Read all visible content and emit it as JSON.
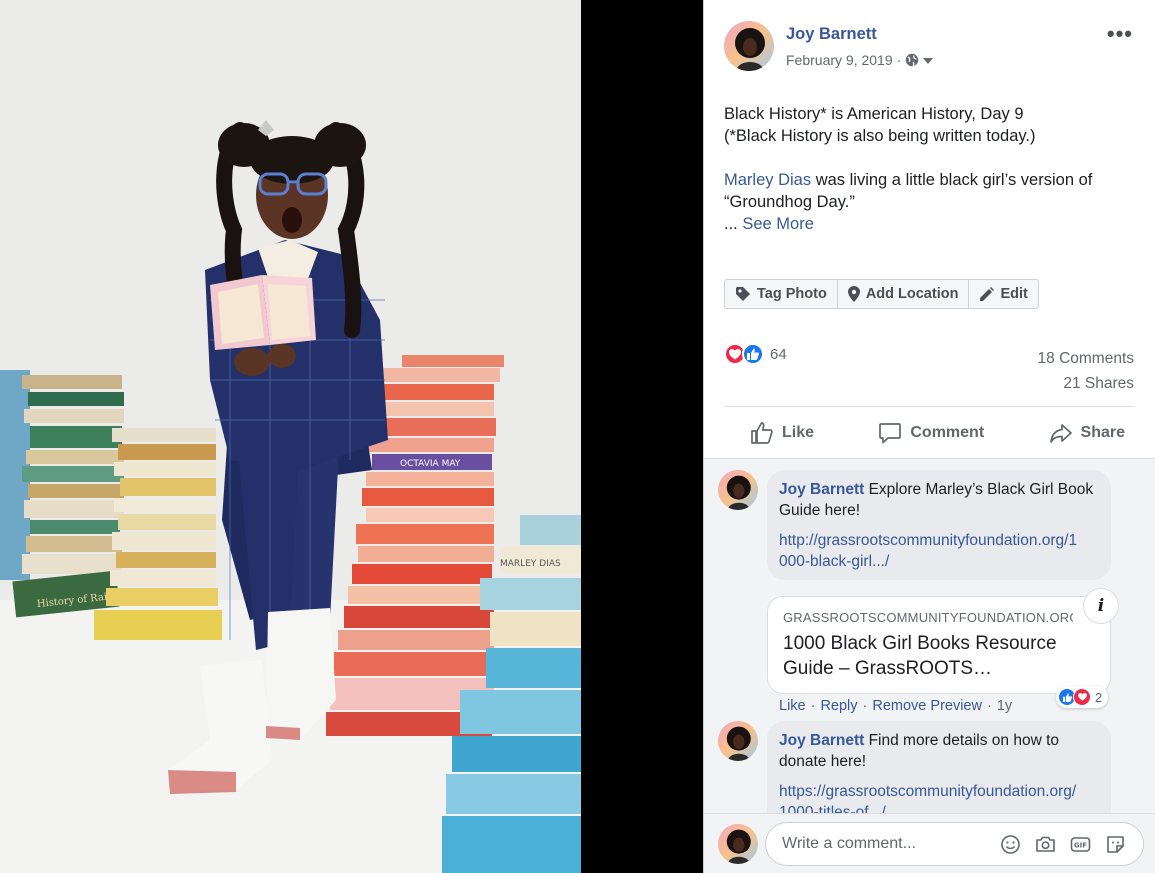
{
  "post": {
    "author": "Joy Barnett",
    "date": "February 9, 2019",
    "date_sep": "·",
    "text_line1": "Black History* is American History, Day 9",
    "text_line2": "(*Black History is also being written today.)",
    "mention": "Marley Dias",
    "text_line3_rest": " was living a little black girl’s version of",
    "text_line4": "“Groundhog Day.”",
    "ellipsis": "... ",
    "see_more": "See More"
  },
  "toolbar": {
    "tag_photo": "Tag Photo",
    "add_location": "Add Location",
    "edit": "Edit"
  },
  "stats": {
    "reaction_count": "64",
    "comments": "18 Comments",
    "shares": "21 Shares"
  },
  "actions": {
    "like": "Like",
    "comment": "Comment",
    "share": "Share"
  },
  "comments": [
    {
      "author": "Joy Barnett",
      "text": " Explore Marley’s Black Girl Book Guide here!",
      "url_line1": "http://grassrootscommunityfoundation.org/1",
      "url_line2": "000-black-girl.../",
      "preview_domain": "GRASSROOTSCOMMUNITYFOUNDATION.ORG",
      "preview_title_line1": "1000 Black Girl Books Resource",
      "preview_title_line2": "Guide – GrassROOTS…",
      "like": "Like",
      "reply": "Reply",
      "remove_preview": "Remove Preview",
      "time": "1y",
      "reaction_count": "2"
    },
    {
      "author": "Joy Barnett",
      "text": " Find more details on how to donate here!",
      "url_line1": "https://grassrootscommunityfoundation.org/",
      "url_line2": "1000-titles-of.../"
    }
  ],
  "write": {
    "placeholder": "Write a comment..."
  },
  "icons": {
    "more": "more-options-icon",
    "globe": "globe-icon",
    "tag": "tag-icon",
    "location": "location-pin-icon",
    "edit": "pencil-icon",
    "love": "love-reaction-icon",
    "like": "like-reaction-icon",
    "info": "info-icon",
    "emoji": "emoji-icon",
    "camera": "camera-icon",
    "gif": "gif-icon",
    "sticker": "sticker-icon"
  },
  "colors": {
    "link": "#385898",
    "love": "#f0284a",
    "like": "#1877f2",
    "comment_bg": "#f2f3f5"
  }
}
